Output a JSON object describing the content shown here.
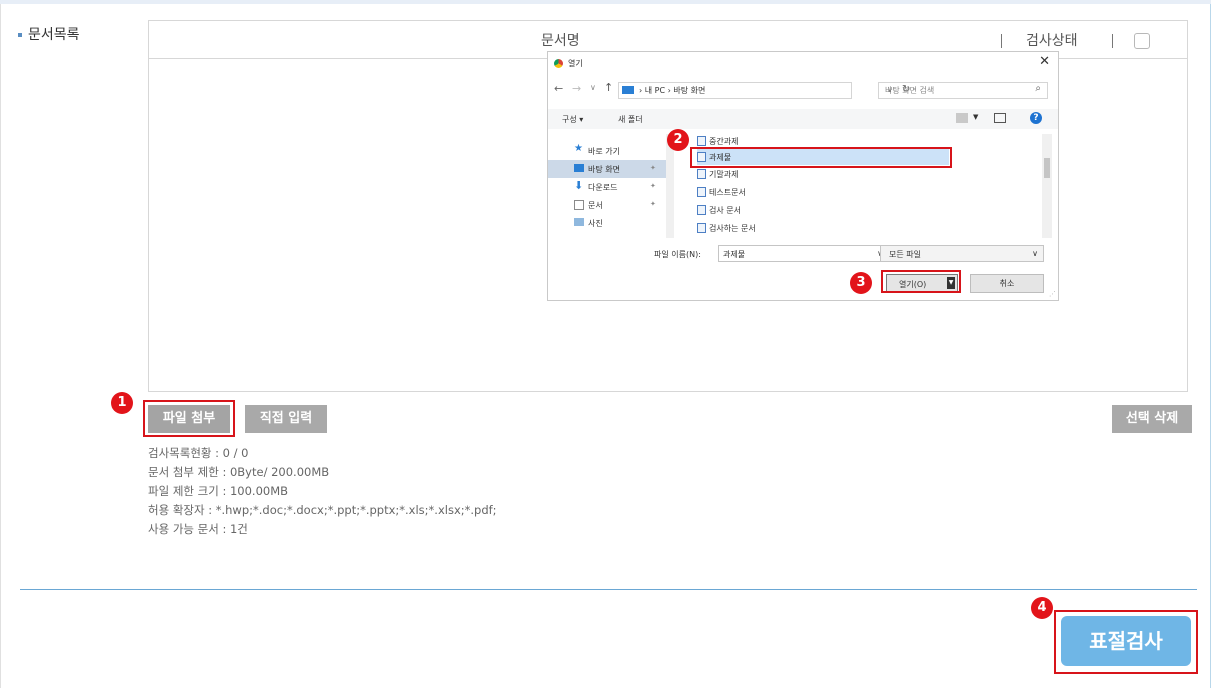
{
  "section": {
    "label": "문서목록"
  },
  "table": {
    "col_docname": "문서명",
    "col_status": "검사상태"
  },
  "dialog": {
    "title": "열기",
    "close": "✕",
    "address": "› 내 PC › 바탕 화면",
    "search_placeholder": "바탕 화면 검색",
    "toolbar": {
      "organize": "구성 ▾",
      "new_folder": "새 폴더",
      "help": "?"
    },
    "nav_items": [
      {
        "label": "바로 가기",
        "icon": "star-icon"
      },
      {
        "label": "바탕 화면",
        "icon": "desktop-icon"
      },
      {
        "label": "다운로드",
        "icon": "download-icon"
      },
      {
        "label": "문서",
        "icon": "document-icon"
      },
      {
        "label": "사진",
        "icon": "picture-icon"
      }
    ],
    "files": [
      "중간과제",
      "과제물",
      "기말과제",
      "테스트문서",
      "검사 문서",
      "검사하는 문서"
    ],
    "filename_label": "파일 이름(N):",
    "filename_value": "과제물",
    "filetype_value": "모든 파일",
    "open_button": "열기(O)",
    "cancel_button": "취소"
  },
  "markers": [
    "1",
    "2",
    "3",
    "4"
  ],
  "buttons": {
    "attach": "파일 첨부",
    "direct": "직접 입력",
    "delete": "선택 삭제",
    "plagiarism": "표절검사"
  },
  "info": [
    "검사목록현황 : 0 / 0",
    "문서 첨부 제한 : 0Byte/ 200.00MB",
    "파일 제한 크기 : 100.00MB",
    "허용 확장자 : *.hwp;*.doc;*.docx;*.ppt;*.pptx;*.xls;*.xlsx;*.pdf;",
    "사용 가능 문서 : 1건"
  ],
  "colors": {
    "highlight": "#d7141a",
    "marker": "#e2141a",
    "primary_button": "#6fb6e6",
    "gray_button": "#a9a9a9"
  }
}
